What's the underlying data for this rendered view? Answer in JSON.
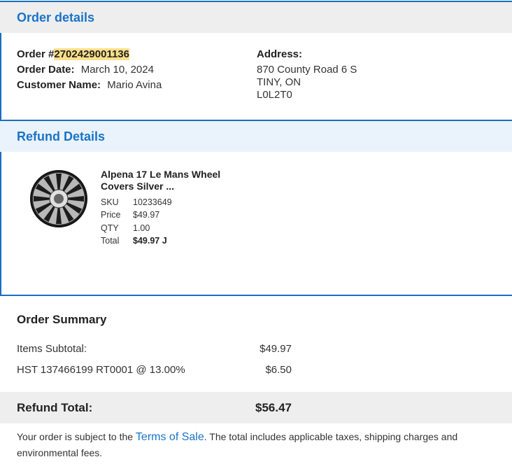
{
  "order_section": {
    "title": "Order details",
    "order_label": "Order #",
    "order_number": "2702429001136",
    "date_label": "Order Date:",
    "date_value": "March 10, 2024",
    "customer_label": "Customer Name:",
    "customer_value": "Mario Avina",
    "address_label": "Address:",
    "address_line1": "870 County Road 6 S",
    "address_line2": "TINY, ON",
    "address_line3": "L0L2T0"
  },
  "refund_section": {
    "title": "Refund Details",
    "item": {
      "name_line1": "Alpena 17 Le Mans Wheel",
      "name_line2": "Covers Silver ...",
      "sku_label": "SKU",
      "sku_value": "10233649",
      "price_label": "Price",
      "price_value": "$49.97",
      "qty_label": "QTY",
      "qty_value": "1.00",
      "total_label": "Total",
      "total_value": "$49.97 J",
      "image_icon": "wheel-cover-icon"
    }
  },
  "summary": {
    "title": "Order Summary",
    "subtotal_label": "Items Subtotal:",
    "subtotal_value": "$49.97",
    "tax_label": "HST 137466199 RT0001 @ 13.00%",
    "tax_value": "$6.50",
    "refund_total_label": "Refund Total:",
    "refund_total_value": "$56.47"
  },
  "footer": {
    "text_before": "Your order is subject to the ",
    "link_text": "Terms of Sale",
    "text_after_line1": ". The total includes applicable taxes, shipping charges and",
    "text_line2": "environmental fees."
  },
  "colors": {
    "accent_blue": "#1a73c8",
    "highlight": "#fde08a"
  }
}
